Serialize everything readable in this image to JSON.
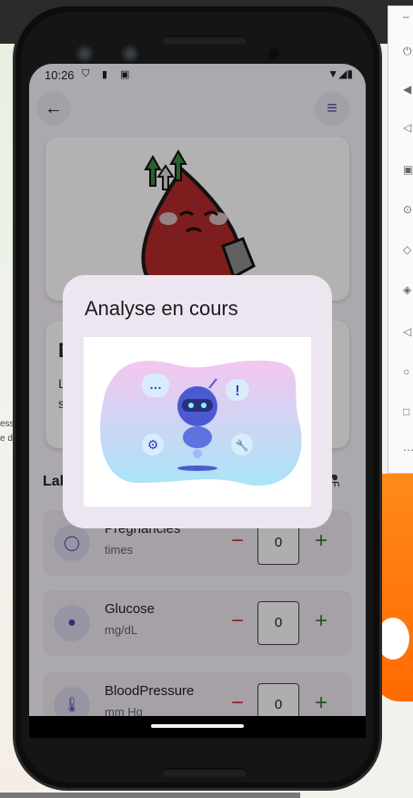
{
  "status_bar": {
    "time": "10:26"
  },
  "app": {
    "info_card": {
      "title_partial": "D",
      "body_partial": "L a s"
    },
    "section_title_partial": "Lab",
    "fields": [
      {
        "name": "Pregnancies",
        "unit": "times",
        "value": "0"
      },
      {
        "name": "Glucose",
        "unit": "mg/dL",
        "value": "0"
      },
      {
        "name": "BloodPressure",
        "unit": "mm Hg",
        "value": "0"
      }
    ],
    "minus_label": "−",
    "plus_label": "+"
  },
  "dialog": {
    "title": "Analyse en cours"
  },
  "desktop": {
    "left_text_1": "ess",
    "left_text_2": "e de"
  },
  "colors": {
    "minus": "#d32f2f",
    "plus": "#2e7d32",
    "accent": "#3e4aa6"
  }
}
